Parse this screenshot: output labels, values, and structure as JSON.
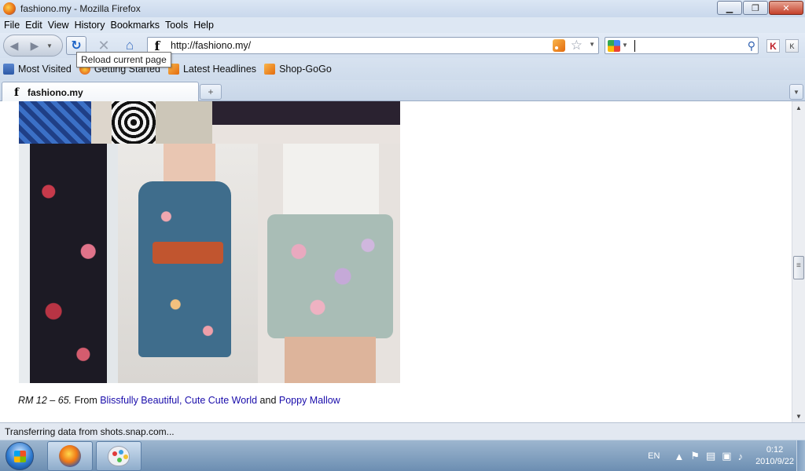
{
  "window": {
    "title": "fashiono.my - Mozilla Firefox",
    "controls": {
      "minimize": "▁",
      "maximize": "❐",
      "close": "✕"
    }
  },
  "menu": [
    "File",
    "Edit",
    "View",
    "History",
    "Bookmarks",
    "Tools",
    "Help"
  ],
  "nav": {
    "back_icon": "arrow-left-icon",
    "forward_icon": "arrow-right-icon",
    "reload_tooltip": "Reload current page",
    "url": "http://fashiono.my/",
    "site_favicon_glyph": "f",
    "search_value": ""
  },
  "bookmarks": [
    {
      "label": "Most Visited",
      "icon": "star"
    },
    {
      "label": "Getting Started",
      "icon": "fx"
    },
    {
      "label": "Latest Headlines",
      "icon": "rss"
    },
    {
      "label": "Shop-GoGo",
      "icon": "rss"
    }
  ],
  "tabs": [
    {
      "label": "fashiono.my",
      "favicon_glyph": "f",
      "active": true
    }
  ],
  "content": {
    "caption": {
      "price": "RM 12 – 65.",
      "from_text": " From ",
      "link1": "Blissfully Beautiful,",
      "space": " ",
      "link2": "Cute Cute World",
      "and_text": " and ",
      "link3": "Poppy Mallow"
    }
  },
  "status": {
    "text": "Transferring data from shots.snap.com..."
  },
  "taskbar": {
    "apps": [
      "firefox-icon",
      "paint-icon"
    ],
    "language": "EN",
    "time": "0:12",
    "date": "2010/9/22"
  },
  "colors": {
    "link": "#1a0dab",
    "chrome_bg": "#dfe8f4",
    "taskbar": "#6c8eb2"
  }
}
